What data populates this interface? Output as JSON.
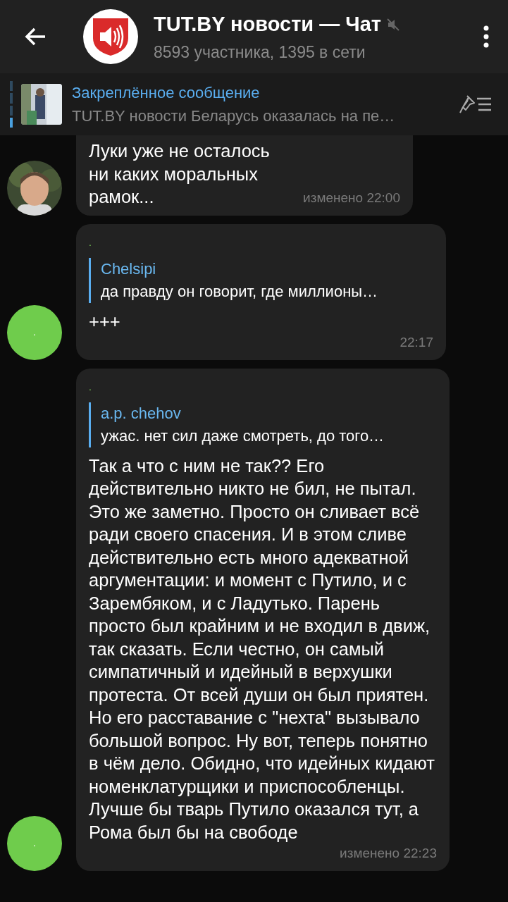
{
  "header": {
    "title": "TUT.BY новости — Чат",
    "muted": true,
    "subtitle": "8593 участника, 1395 в сети"
  },
  "pinned": {
    "label": "Закреплённое сообщение",
    "text": "TUT.BY новости Беларусь оказалась на пе…"
  },
  "messages": [
    {
      "text": "Луки уже не осталось ни каких моральных рамок...",
      "time": "изменено 22:00"
    },
    {
      "kind": "letter",
      "avatar_letter": ".",
      "color": "#6fcc4c",
      "sender": ".",
      "reply": {
        "author": "Chelsipi",
        "text": "да правду он говорит, где миллионы…"
      },
      "text": "+++",
      "time": "22:17"
    },
    {
      "kind": "letter",
      "avatar_letter": ".",
      "color": "#6fcc4c",
      "sender": ".",
      "reply": {
        "author": "a.p. chehov",
        "text": "ужас. нет сил даже смотреть, до того…"
      },
      "text": "Так а что с ним не так?? Его действительно никто не бил, не пытал. Это же заметно. Просто он сливает всё ради своего спасения. И в этом сливе действительно есть много адекватной аргументации: и момент с Путило, и с Зарембяком, и с Ладутько. Парень просто был крайним и не входил в движ, так сказать. Если честно, он самый симпатичный и идейный в верхушки протеста. От всей души он был приятен. Но его расставание с \"нехта\" вызывало большой вопрос. Ну вот, теперь понятно в чём дело. Обидно, что идейных кидают номенклатурщики и приспособленцы. Лучше бы тварь Путило оказался тут, а Рома был бы на свободе",
      "time": "изменено 22:23"
    }
  ]
}
